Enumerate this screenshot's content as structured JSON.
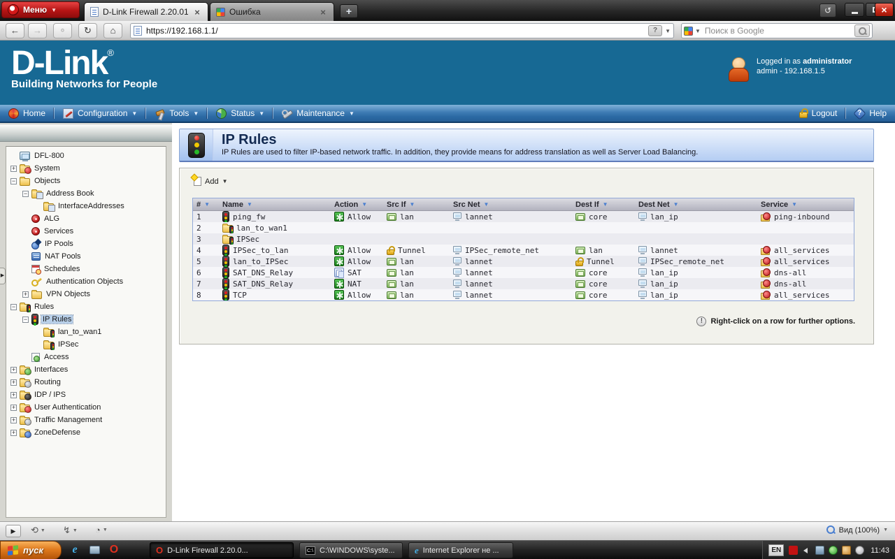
{
  "glyphs": {
    "caret_down": "▼",
    "close": "×",
    "new_tab": "+",
    "reopen": "↺",
    "back": "←",
    "forward": "→",
    "reload": "↻",
    "home": "⌂",
    "question": "?",
    "info": "!",
    "sort": "▼",
    "expand_plus": "+",
    "expand_minus": "−",
    "panel_handle": "▶",
    "opera_o": "O",
    "ie_e": "e",
    "cmd": "C:\\"
  },
  "browser": {
    "menu_label": "Меню",
    "tabs": [
      {
        "title": "D-Link Firewall 2.20.01",
        "favicon": "page-icon",
        "active": true
      },
      {
        "title": "Ошибка",
        "favicon": "google-icon",
        "active": false
      }
    ],
    "address": "https://192.168.1.1/",
    "search_placeholder": "Поиск в Google",
    "statusbar_groups": [
      {
        "name": "sync"
      },
      {
        "name": "turbo"
      },
      {
        "name": "history"
      }
    ],
    "zoom_label": "Вид (100%)"
  },
  "header": {
    "logo_text": "D-Link",
    "logo_reg": "®",
    "tagline": "Building Networks for People",
    "login_prefix": "Logged in as ",
    "login_user": "administrator",
    "login_detail": "admin - 192.168.1.5"
  },
  "nav": {
    "items": [
      {
        "label": "Home",
        "icon": "home-icon",
        "dropdown": false
      },
      {
        "label": "Configuration",
        "icon": "configuration-icon",
        "dropdown": true
      },
      {
        "label": "Tools",
        "icon": "tools-icon",
        "dropdown": true
      },
      {
        "label": "Status",
        "icon": "status-icon",
        "dropdown": true
      },
      {
        "label": "Maintenance",
        "icon": "maintenance-icon",
        "dropdown": true
      }
    ],
    "right_items": [
      {
        "label": "Logout",
        "icon": "logout-lock-icon"
      },
      {
        "label": "Help",
        "icon": "help-icon"
      }
    ]
  },
  "sidebar": {
    "tree": [
      {
        "label": "DFL-800",
        "icon": "device",
        "depth": 0,
        "expander": null,
        "selected": false
      },
      {
        "label": "System",
        "icon": "system",
        "depth": 0,
        "expander": "plus",
        "selected": false
      },
      {
        "label": "Objects",
        "icon": "folder",
        "depth": 0,
        "expander": "minus",
        "selected": false
      },
      {
        "label": "Address Book",
        "icon": "addressbook",
        "depth": 1,
        "expander": "minus",
        "selected": false
      },
      {
        "label": "InterfaceAddresses",
        "icon": "addressbook",
        "depth": 2,
        "expander": null,
        "selected": false
      },
      {
        "label": "ALG",
        "icon": "gear",
        "depth": 1,
        "expander": null,
        "selected": false
      },
      {
        "label": "Services",
        "icon": "gear",
        "depth": 1,
        "expander": null,
        "selected": false
      },
      {
        "label": "IP Pools",
        "icon": "ippool",
        "depth": 1,
        "expander": null,
        "selected": false
      },
      {
        "label": "NAT Pools",
        "icon": "natpool",
        "depth": 1,
        "expander": null,
        "selected": false
      },
      {
        "label": "Schedules",
        "icon": "schedule",
        "depth": 1,
        "expander": null,
        "selected": false
      },
      {
        "label": "Authentication Objects",
        "icon": "auth",
        "depth": 1,
        "expander": null,
        "selected": false
      },
      {
        "label": "VPN Objects",
        "icon": "folder",
        "depth": 1,
        "expander": "plus",
        "selected": false
      },
      {
        "label": "Rules",
        "icon": "rules-folder",
        "depth": 0,
        "expander": "minus",
        "selected": false
      },
      {
        "label": "IP Rules",
        "icon": "traffic",
        "depth": 1,
        "expander": "minus",
        "selected": true
      },
      {
        "label": "lan_to_wan1",
        "icon": "rules-folder",
        "depth": 2,
        "expander": null,
        "selected": false
      },
      {
        "label": "IPSec",
        "icon": "rules-folder",
        "depth": 2,
        "expander": null,
        "selected": false
      },
      {
        "label": "Access",
        "icon": "access",
        "depth": 1,
        "expander": null,
        "selected": false
      },
      {
        "label": "Interfaces",
        "icon": "interfaces",
        "depth": 0,
        "expander": "plus",
        "selected": false
      },
      {
        "label": "Routing",
        "icon": "routing",
        "depth": 0,
        "expander": "plus",
        "selected": false
      },
      {
        "label": "IDP / IPS",
        "icon": "idp",
        "depth": 0,
        "expander": "plus",
        "selected": false
      },
      {
        "label": "User Authentication",
        "icon": "user-auth",
        "depth": 0,
        "expander": "plus",
        "selected": false
      },
      {
        "label": "Traffic Management",
        "icon": "traffic-mgmt",
        "depth": 0,
        "expander": "plus",
        "selected": false
      },
      {
        "label": "ZoneDefense",
        "icon": "zonedefense",
        "depth": 0,
        "expander": "plus",
        "selected": false
      }
    ]
  },
  "main": {
    "title": "IP Rules",
    "description": "IP Rules are used to filter IP-based network traffic. In addition, they provide means for address translation as well as Server Load Balancing.",
    "add_label": "Add",
    "note": "Right-click on a row for further options.",
    "table": {
      "columns": [
        "#",
        "Name",
        "Action",
        "Src If",
        "Src Net",
        "Dest If",
        "Dest Net",
        "Service"
      ],
      "rows": [
        {
          "num": "1",
          "name": "ping_fw",
          "name_icon": "traffic",
          "action": "Allow",
          "action_icon": "allow",
          "src_if": "lan",
          "src_if_icon": "nic",
          "src_net": "lannet",
          "src_net_icon": "host",
          "dest_if": "core",
          "dest_if_icon": "nic",
          "dest_net": "lan_ip",
          "dest_net_icon": "host",
          "service": "ping-inbound",
          "service_icon": "service"
        },
        {
          "num": "2",
          "name": "lan_to_wan1",
          "name_icon": "rules-folder"
        },
        {
          "num": "3",
          "name": "IPSec",
          "name_icon": "rules-folder"
        },
        {
          "num": "4",
          "name": "IPSec_to_lan",
          "name_icon": "traffic",
          "action": "Allow",
          "action_icon": "allow",
          "src_if": "Tunnel",
          "src_if_icon": "lock",
          "src_net": "IPSec_remote_net",
          "src_net_icon": "host",
          "dest_if": "lan",
          "dest_if_icon": "nic",
          "dest_net": "lannet",
          "dest_net_icon": "host",
          "service": "all_services",
          "service_icon": "service"
        },
        {
          "num": "5",
          "name": "lan_to_IPSec",
          "name_icon": "traffic",
          "action": "Allow",
          "action_icon": "allow",
          "src_if": "lan",
          "src_if_icon": "nic",
          "src_net": "lannet",
          "src_net_icon": "host",
          "dest_if": "Tunnel",
          "dest_if_icon": "lock",
          "dest_net": "IPSec_remote_net",
          "dest_net_icon": "host",
          "service": "all_services",
          "service_icon": "service"
        },
        {
          "num": "6",
          "name": "SAT_DNS_Relay",
          "name_icon": "traffic",
          "action": "SAT",
          "action_icon": "sat",
          "src_if": "lan",
          "src_if_icon": "nic",
          "src_net": "lannet",
          "src_net_icon": "host",
          "dest_if": "core",
          "dest_if_icon": "nic",
          "dest_net": "lan_ip",
          "dest_net_icon": "host",
          "service": "dns-all",
          "service_icon": "service"
        },
        {
          "num": "7",
          "name": "SAT_DNS_Relay",
          "name_icon": "traffic",
          "action": "NAT",
          "action_icon": "allow",
          "src_if": "lan",
          "src_if_icon": "nic",
          "src_net": "lannet",
          "src_net_icon": "host",
          "dest_if": "core",
          "dest_if_icon": "nic",
          "dest_net": "lan_ip",
          "dest_net_icon": "host",
          "service": "dns-all",
          "service_icon": "service"
        },
        {
          "num": "8",
          "name": "TCP",
          "name_icon": "traffic",
          "action": "Allow",
          "action_icon": "allow",
          "src_if": "lan",
          "src_if_icon": "nic",
          "src_net": "lannet",
          "src_net_icon": "host",
          "dest_if": "core",
          "dest_if_icon": "nic",
          "dest_net": "lan_ip",
          "dest_net_icon": "host",
          "service": "all_services",
          "service_icon": "service"
        }
      ]
    }
  },
  "taskbar": {
    "start_label": "пуск",
    "quicklaunch": [
      {
        "name": "internet-explorer"
      },
      {
        "name": "show-desktop"
      },
      {
        "name": "opera"
      }
    ],
    "buttons": [
      {
        "label": "D-Link Firewall 2.20.0...",
        "icon": "opera",
        "active": true
      },
      {
        "label": "C:\\WINDOWS\\syste...",
        "icon": "cmd",
        "active": false
      },
      {
        "label": "Internet Explorer не ...",
        "icon": "internet-explorer",
        "active": false
      }
    ],
    "language": "EN",
    "tray_icons": [
      {
        "name": "ati"
      },
      {
        "name": "volume"
      },
      {
        "name": "network"
      },
      {
        "name": "antivirus"
      },
      {
        "name": "updater"
      },
      {
        "name": "clock"
      }
    ],
    "time": "11:43"
  }
}
